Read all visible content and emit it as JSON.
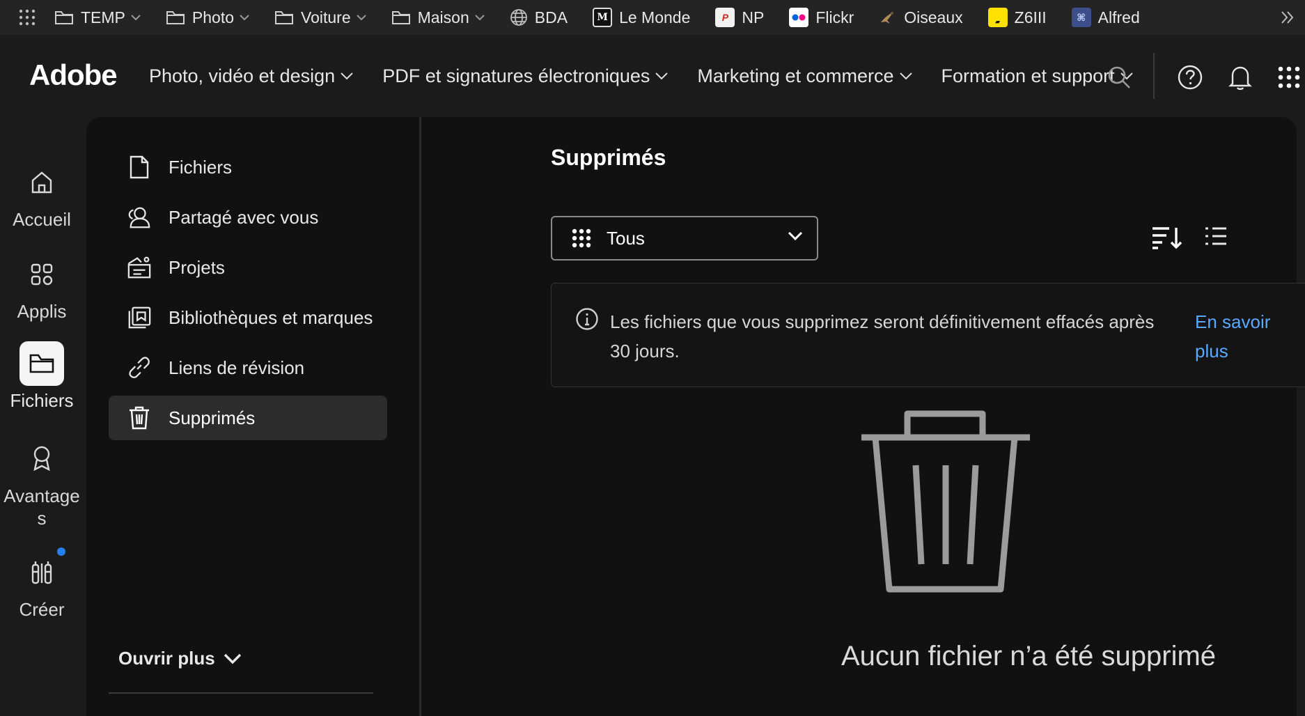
{
  "bookmarks": [
    {
      "label": "TEMP",
      "icon": "folder-icon",
      "has_menu": true
    },
    {
      "label": "Photo",
      "icon": "folder-icon",
      "has_menu": true
    },
    {
      "label": "Voiture",
      "icon": "folder-icon",
      "has_menu": true
    },
    {
      "label": "Maison",
      "icon": "folder-icon",
      "has_menu": true
    },
    {
      "label": "BDA",
      "icon": "globe-icon",
      "has_menu": false
    },
    {
      "label": "Le Monde",
      "icon": "le-monde-favicon",
      "has_menu": false
    },
    {
      "label": "NP",
      "icon": "np-favicon",
      "has_menu": false
    },
    {
      "label": "Flickr",
      "icon": "flickr-favicon",
      "has_menu": false
    },
    {
      "label": "Oiseaux",
      "icon": "bird-favicon",
      "has_menu": false
    },
    {
      "label": "Z6III",
      "icon": "nikon-favicon",
      "has_menu": false
    },
    {
      "label": "Alfred",
      "icon": "alfred-favicon",
      "has_menu": false
    }
  ],
  "header": {
    "logo": "Adobe",
    "menu": [
      "Photo, vidéo et design",
      "PDF et signatures électroniques",
      "Marketing et commerce",
      "Formation et support"
    ]
  },
  "rail": {
    "items": [
      {
        "label": "Accueil",
        "icon": "home-icon"
      },
      {
        "label": "Applis",
        "icon": "apps-icon"
      },
      {
        "label": "Fichiers",
        "icon": "folder-icon",
        "active": true
      },
      {
        "label": "Avantage s",
        "icon": "award-icon"
      },
      {
        "label": "Créer",
        "icon": "create-icon",
        "badge": true
      }
    ]
  },
  "subnav": {
    "items": [
      {
        "label": "Fichiers",
        "icon": "file-icon"
      },
      {
        "label": "Partagé avec vous",
        "icon": "shared-users-icon"
      },
      {
        "label": "Projets",
        "icon": "projects-icon"
      },
      {
        "label": "Bibliothèques et marques",
        "icon": "libraries-icon"
      },
      {
        "label": "Liens de révision",
        "icon": "link-icon"
      },
      {
        "label": "Supprimés",
        "icon": "trash-icon",
        "active": true
      }
    ],
    "open_more": "Ouvrir plus"
  },
  "main": {
    "title": "Supprimés",
    "filter": {
      "value": "Tous"
    },
    "notice": {
      "text": "Les fichiers que vous supprimez seront définitivement effacés après 30 jours.",
      "link": "En savoir plus"
    },
    "empty_text": "Aucun fichier n’a été supprimé"
  },
  "colors": {
    "background": "#1b1b1b",
    "panel": "#111111",
    "link": "#5aa9ff",
    "badge": "#2680eb"
  }
}
